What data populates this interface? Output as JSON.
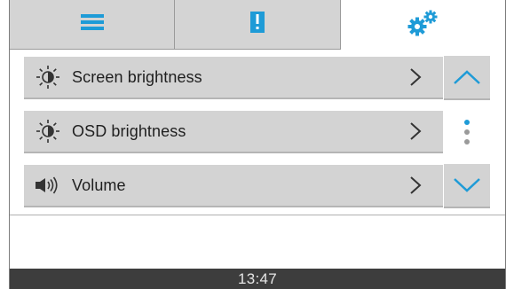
{
  "tabs": [
    {
      "icon": "menu-icon",
      "active": false
    },
    {
      "icon": "alert-icon",
      "active": false
    },
    {
      "icon": "gears-icon",
      "active": true
    }
  ],
  "settings": {
    "items": [
      {
        "label": "Screen brightness",
        "icon": "brightness-icon"
      },
      {
        "label": "OSD brightness",
        "icon": "brightness-icon"
      },
      {
        "label": "Volume",
        "icon": "volume-icon"
      }
    ]
  },
  "scroll": {
    "up_icon": "chevron-up-icon",
    "down_icon": "chevron-down-icon",
    "page_indicator": {
      "pages": 3,
      "current": 1
    }
  },
  "status": {
    "time": "13:47"
  },
  "colors": {
    "accent": "#1e9bd7",
    "tab_inactive": "#d4d4d4",
    "row_bg": "#d3d3d3",
    "status_bar": "#3d3d3d",
    "dot_inactive": "#9a9a9a"
  }
}
